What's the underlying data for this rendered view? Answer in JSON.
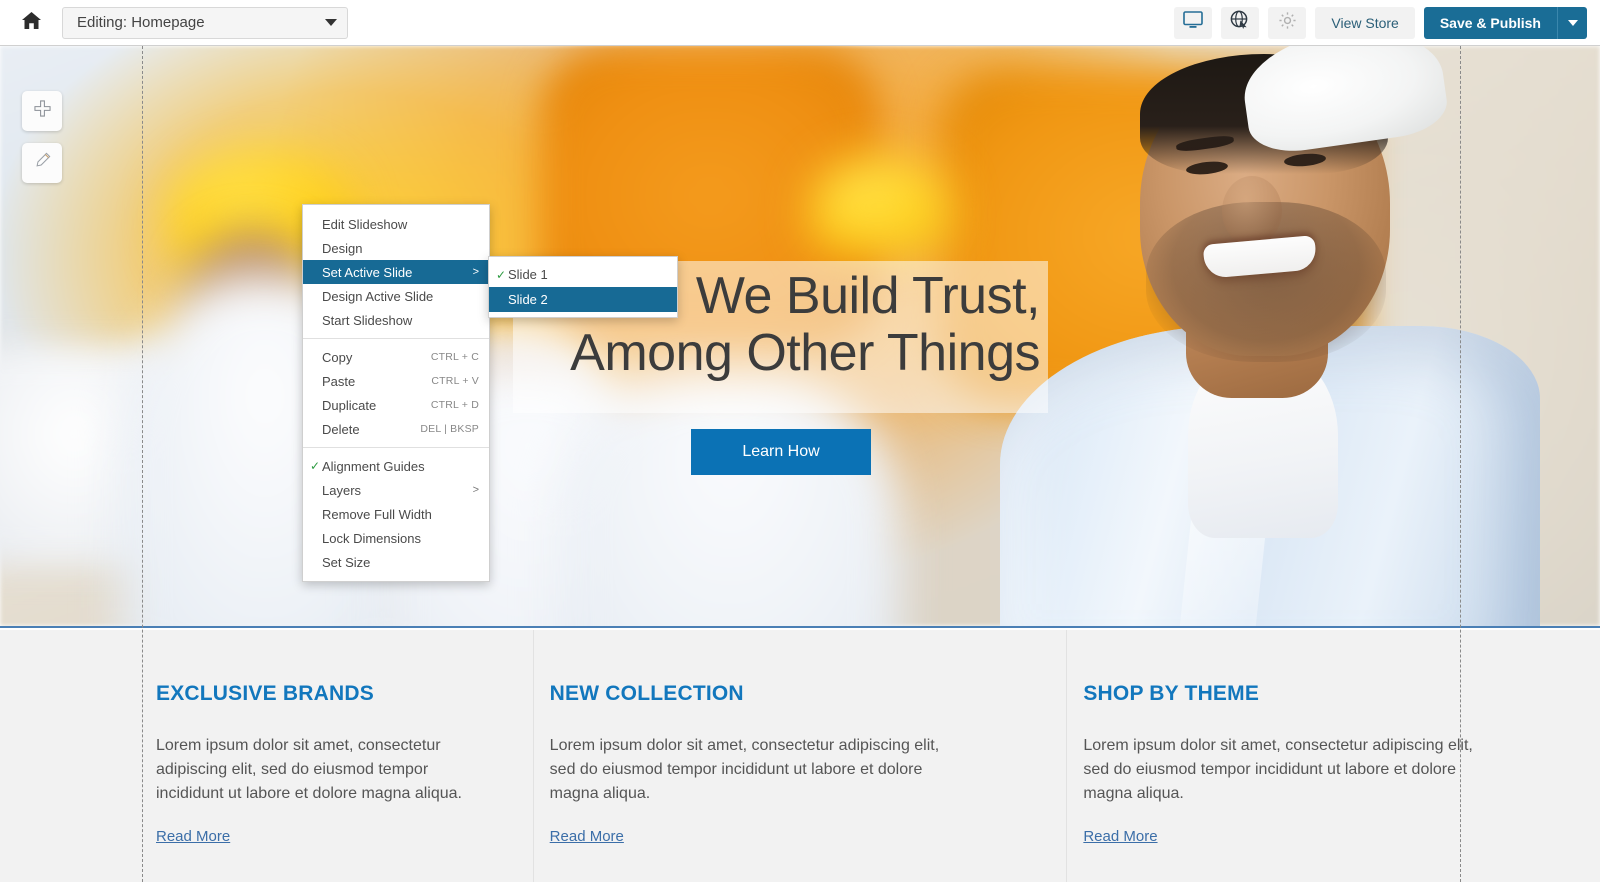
{
  "toolbar": {
    "home_icon": "home-icon",
    "page_select_value": "Editing: Homepage",
    "icons": [
      {
        "name": "desktop-preview-icon",
        "label": "desktop-preview"
      },
      {
        "name": "globe-cursor-icon",
        "label": "globe-cursor"
      },
      {
        "name": "gear-icon",
        "label": "settings"
      }
    ],
    "view_store_label": "View Store",
    "save_publish_label": "Save & Publish",
    "publish_caret": "chevron-down-icon",
    "accent_color": "#1a6d96"
  },
  "side_tools": [
    {
      "name": "add-element-button",
      "icon": "plus-icon"
    },
    {
      "name": "edit-element-button",
      "icon": "pencil-icon"
    }
  ],
  "context_menu": {
    "items": [
      {
        "label": "Edit Slideshow",
        "shortcut": "",
        "checked": false,
        "submenu": false,
        "selected": false
      },
      {
        "label": "Design",
        "shortcut": "",
        "checked": false,
        "submenu": false,
        "selected": false
      },
      {
        "label": "Set Active Slide",
        "shortcut": "",
        "checked": false,
        "submenu": true,
        "selected": true
      },
      {
        "label": "Design Active Slide",
        "shortcut": "",
        "checked": false,
        "submenu": false,
        "selected": false
      },
      {
        "label": "Start Slideshow",
        "shortcut": "",
        "checked": false,
        "submenu": false,
        "selected": false
      },
      {
        "separator": true
      },
      {
        "label": "Copy",
        "shortcut": "CTRL + C",
        "checked": false,
        "submenu": false,
        "selected": false
      },
      {
        "label": "Paste",
        "shortcut": "CTRL + V",
        "checked": false,
        "submenu": false,
        "selected": false
      },
      {
        "label": "Duplicate",
        "shortcut": "CTRL + D",
        "checked": false,
        "submenu": false,
        "selected": false
      },
      {
        "label": "Delete",
        "shortcut": "DEL | BKSP",
        "checked": false,
        "submenu": false,
        "selected": false
      },
      {
        "separator": true
      },
      {
        "label": "Alignment Guides",
        "shortcut": "",
        "checked": true,
        "submenu": false,
        "selected": false
      },
      {
        "label": "Layers",
        "shortcut": "",
        "checked": false,
        "submenu": true,
        "selected": false
      },
      {
        "label": "Remove Full Width",
        "shortcut": "",
        "checked": false,
        "submenu": false,
        "selected": false
      },
      {
        "label": "Lock Dimensions",
        "shortcut": "",
        "checked": false,
        "submenu": false,
        "selected": false
      },
      {
        "label": "Set Size",
        "shortcut": "",
        "checked": false,
        "submenu": false,
        "selected": false
      }
    ],
    "submenu": {
      "items": [
        {
          "label": "Slide 1",
          "checked": true,
          "selected": false
        },
        {
          "label": "Slide 2",
          "checked": false,
          "selected": true
        }
      ]
    },
    "highlight_color": "#176a95",
    "check_color": "#2e9b42"
  },
  "hero": {
    "title_line1": "We Build Trust,",
    "title_line2": "Among Other Things",
    "cta_label": "Learn How",
    "cta_color": "#0b72b5"
  },
  "lower_columns": [
    {
      "title": "EXCLUSIVE BRANDS",
      "body": "Lorem ipsum dolor sit amet, consectetur adipiscing elit, sed do eiusmod tempor incididunt ut labore et dolore magna aliqua.",
      "link": "Read More"
    },
    {
      "title": "NEW COLLECTION",
      "body": "Lorem ipsum dolor sit amet, consectetur adipiscing elit, sed do eiusmod tempor incididunt ut labore et dolore magna aliqua.",
      "link": "Read More"
    },
    {
      "title": "SHOP BY THEME",
      "body": "Lorem ipsum dolor sit amet, consectetur adipiscing elit, sed do eiusmod tempor incididunt ut labore et dolore magna aliqua.",
      "link": "Read More"
    }
  ],
  "column_title_color": "#1277bd"
}
